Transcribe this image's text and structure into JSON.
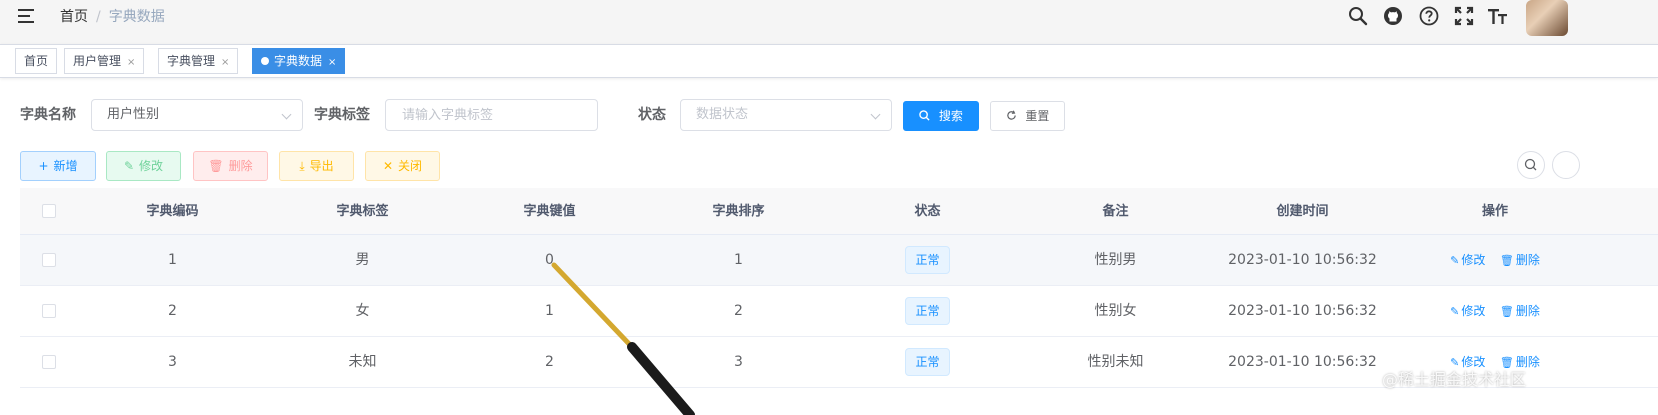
{
  "header": {
    "breadcrumb": {
      "home": "首页",
      "separator": "/",
      "current": "字典数据"
    },
    "icons": [
      "search-icon",
      "github-icon",
      "question-icon",
      "fullscreen-icon",
      "font-size-icon"
    ]
  },
  "tags": [
    {
      "label": "首页",
      "active": false,
      "closable": false
    },
    {
      "label": "用户管理",
      "active": false,
      "closable": true
    },
    {
      "label": "字典管理",
      "active": false,
      "closable": true
    },
    {
      "label": "字典数据",
      "active": true,
      "closable": true
    }
  ],
  "tag_close_symbol": "×",
  "search": {
    "dict_name_label": "字典名称",
    "dict_name_value": "用户性别",
    "dict_label_label": "字典标签",
    "dict_label_placeholder": "请输入字典标签",
    "status_label": "状态",
    "status_placeholder": "数据状态",
    "search_button": "搜索",
    "reset_button": "重置"
  },
  "toolbar": {
    "add": "新增",
    "edit": "修改",
    "delete": "删除",
    "export": "导出",
    "close": "关闭"
  },
  "table": {
    "columns": [
      "字典编码",
      "字典标签",
      "字典键值",
      "字典排序",
      "状态",
      "备注",
      "创建时间",
      "操作"
    ],
    "rows": [
      {
        "code": "1",
        "label": "男",
        "value": "0",
        "sort": "1",
        "status": "正常",
        "remark": "性别男",
        "created": "2023-01-10 10:56:32"
      },
      {
        "code": "2",
        "label": "女",
        "value": "1",
        "sort": "2",
        "status": "正常",
        "remark": "性别女",
        "created": "2023-01-10 10:56:32"
      },
      {
        "code": "3",
        "label": "未知",
        "value": "2",
        "sort": "3",
        "status": "正常",
        "remark": "性别未知",
        "created": "2023-01-10 10:56:32"
      }
    ],
    "row_actions": {
      "edit": "修改",
      "delete": "删除"
    }
  },
  "watermark": "@稀土掘金技术社区",
  "colors": {
    "primary": "#1890ff",
    "active_tag": "#3a8ee6",
    "success": "#6fd29a",
    "danger": "#ff9b9b",
    "warning": "#ffba00"
  }
}
